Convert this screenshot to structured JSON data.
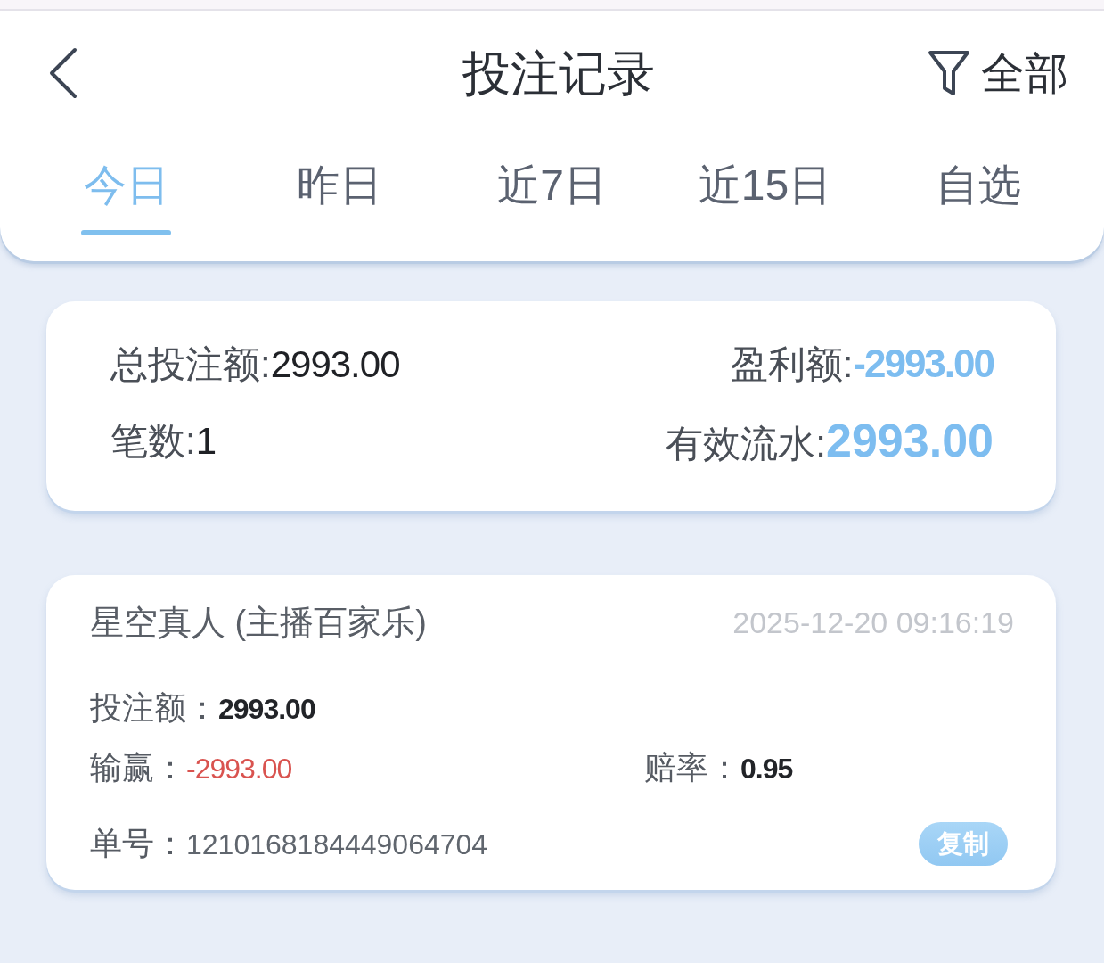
{
  "header": {
    "title": "投注记录",
    "filter": {
      "label": "全部"
    }
  },
  "tabs": [
    {
      "label": "今日",
      "selected": true
    },
    {
      "label": "昨日",
      "selected": false
    },
    {
      "label": "近7日",
      "selected": false
    },
    {
      "label": "近15日",
      "selected": false
    },
    {
      "label": "自选",
      "selected": false
    }
  ],
  "summary": {
    "rows": [
      [
        {
          "label": "总投注额:",
          "value": "2993.00",
          "kind": "plain"
        },
        {
          "label": "盈利额:",
          "value": "-2993.00",
          "kind": "accent"
        }
      ],
      [
        {
          "label": "笔数:",
          "value": "1",
          "kind": "plain"
        },
        {
          "label": "有效流水:",
          "value": "2993.00",
          "kind": "accent-large"
        }
      ]
    ]
  },
  "records": [
    {
      "game": "星空真人 (主播百家乐)",
      "time": "2025-12-20 09:16:19",
      "rows": [
        [
          {
            "label": "投注额：",
            "value": "2993.00",
            "kind": "amount"
          }
        ],
        [
          {
            "label": "输赢：",
            "value": "-2993.00",
            "kind": "loss"
          },
          {
            "label": "赔率：",
            "value": "0.95",
            "kind": "amount"
          }
        ],
        [
          {
            "label": "单号：",
            "value": "1210168184449064704",
            "kind": "serial"
          }
        ]
      ],
      "copy_button": {
        "label": "复制"
      }
    }
  ]
}
